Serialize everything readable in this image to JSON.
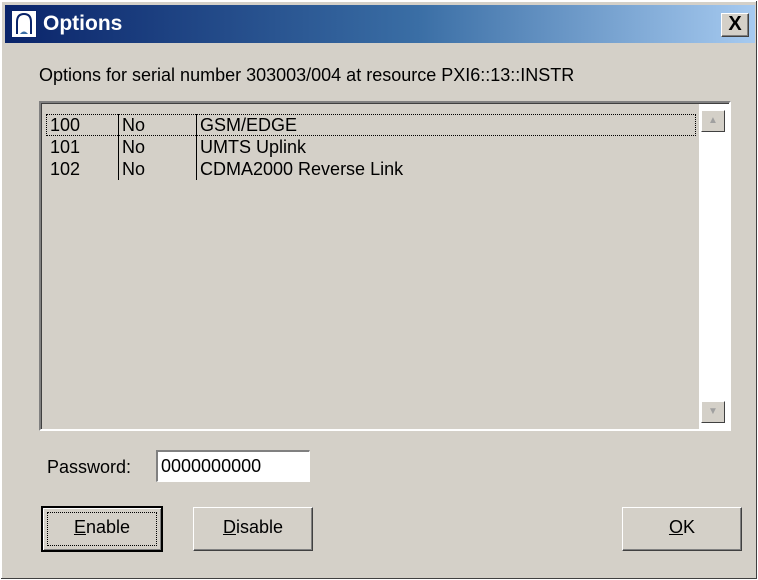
{
  "window": {
    "title": "Options",
    "close_label": "X",
    "icon": "instrument-app-icon"
  },
  "caption": "Options for serial number 303003/004 at resource PXI6::13::INSTR",
  "options_list": {
    "rows": [
      {
        "code": "100",
        "enabled": "No",
        "name": "GSM/EDGE"
      },
      {
        "code": "101",
        "enabled": "No",
        "name": "UMTS Uplink"
      },
      {
        "code": "102",
        "enabled": "No",
        "name": "CDMA2000 Reverse Link"
      }
    ],
    "scroll_up_icon": "arrow-up-icon",
    "scroll_down_icon": "arrow-down-icon"
  },
  "password": {
    "label": "Password:",
    "value": "0000000000"
  },
  "buttons": {
    "enable": {
      "mnemonic": "E",
      "rest": "nable"
    },
    "disable": {
      "mnemonic": "D",
      "rest": "isable"
    },
    "ok": {
      "mnemonic": "O",
      "rest": "K"
    }
  }
}
